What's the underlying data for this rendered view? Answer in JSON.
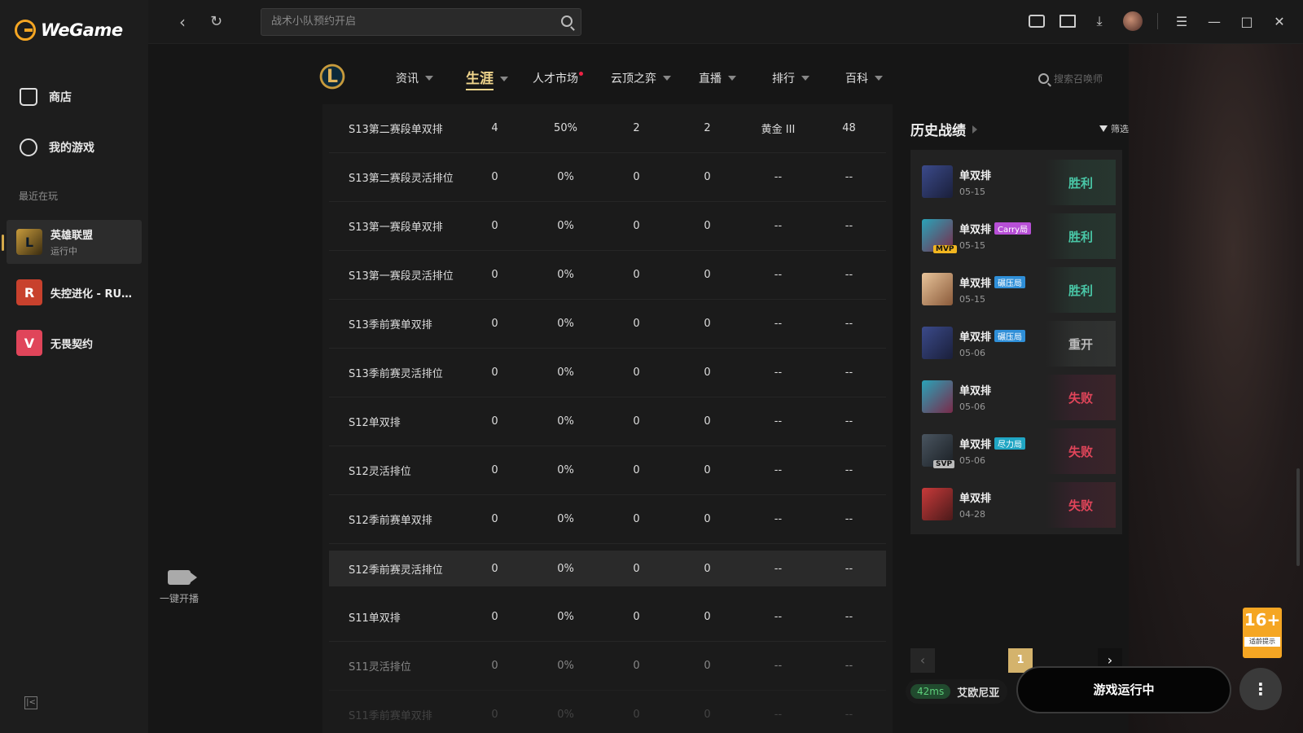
{
  "app": {
    "name": "WeGame"
  },
  "sidebar": {
    "items": [
      {
        "label": "商店",
        "icon": "bag-icon"
      },
      {
        "label": "我的游戏",
        "icon": "gamepad-icon"
      }
    ],
    "recent_label": "最近在玩",
    "games": [
      {
        "name": "英雄联盟",
        "status": "运行中",
        "icon_text": "L"
      },
      {
        "name": "失控进化 - RUS...",
        "status": "",
        "icon_text": "R"
      },
      {
        "name": "无畏契约",
        "status": "",
        "icon_text": "V"
      }
    ],
    "stream_label": "一键开播"
  },
  "topbar": {
    "search_placeholder": "战术小队预约开启"
  },
  "game_nav": {
    "tabs": [
      {
        "label": "资讯"
      },
      {
        "label": "生涯"
      },
      {
        "label": "人才市场"
      },
      {
        "label": "云顶之弈"
      },
      {
        "label": "直播"
      },
      {
        "label": "排行"
      },
      {
        "label": "百科"
      }
    ],
    "summoner_search_placeholder": "搜索召唤师"
  },
  "stats": {
    "rows": [
      {
        "name": "S13第二赛段单双排",
        "c1": "4",
        "c2": "50%",
        "c3": "2",
        "c4": "2",
        "c5": "黄金 III",
        "c6": "48"
      },
      {
        "name": "S13第二赛段灵活排位",
        "c1": "0",
        "c2": "0%",
        "c3": "0",
        "c4": "0",
        "c5": "--",
        "c6": "--"
      },
      {
        "name": "S13第一赛段单双排",
        "c1": "0",
        "c2": "0%",
        "c3": "0",
        "c4": "0",
        "c5": "--",
        "c6": "--"
      },
      {
        "name": "S13第一赛段灵活排位",
        "c1": "0",
        "c2": "0%",
        "c3": "0",
        "c4": "0",
        "c5": "--",
        "c6": "--"
      },
      {
        "name": "S13季前赛单双排",
        "c1": "0",
        "c2": "0%",
        "c3": "0",
        "c4": "0",
        "c5": "--",
        "c6": "--"
      },
      {
        "name": "S13季前赛灵活排位",
        "c1": "0",
        "c2": "0%",
        "c3": "0",
        "c4": "0",
        "c5": "--",
        "c6": "--"
      },
      {
        "name": "S12单双排",
        "c1": "0",
        "c2": "0%",
        "c3": "0",
        "c4": "0",
        "c5": "--",
        "c6": "--"
      },
      {
        "name": "S12灵活排位",
        "c1": "0",
        "c2": "0%",
        "c3": "0",
        "c4": "0",
        "c5": "--",
        "c6": "--"
      },
      {
        "name": "S12季前赛单双排",
        "c1": "0",
        "c2": "0%",
        "c3": "0",
        "c4": "0",
        "c5": "--",
        "c6": "--"
      },
      {
        "name": "S12季前赛灵活排位",
        "c1": "0",
        "c2": "0%",
        "c3": "0",
        "c4": "0",
        "c5": "--",
        "c6": "--"
      },
      {
        "name": "S11单双排",
        "c1": "0",
        "c2": "0%",
        "c3": "0",
        "c4": "0",
        "c5": "--",
        "c6": "--"
      },
      {
        "name": "S11灵活排位",
        "c1": "0",
        "c2": "0%",
        "c3": "0",
        "c4": "0",
        "c5": "--",
        "c6": "--"
      },
      {
        "name": "S11季前赛单双排",
        "c1": "0",
        "c2": "0%",
        "c3": "0",
        "c4": "0",
        "c5": "--",
        "c6": "--"
      }
    ]
  },
  "history": {
    "title": "历史战绩",
    "filter_label": "筛选",
    "matches": [
      {
        "type": "单双排",
        "tag": "",
        "date": "05-15",
        "result": "胜利",
        "badge": ""
      },
      {
        "type": "单双排",
        "tag": "Carry局",
        "date": "05-15",
        "result": "胜利",
        "badge": "MVP"
      },
      {
        "type": "单双排",
        "tag": "碾压局",
        "date": "05-15",
        "result": "胜利",
        "badge": ""
      },
      {
        "type": "单双排",
        "tag": "碾压局",
        "date": "05-06",
        "result": "重开",
        "badge": ""
      },
      {
        "type": "单双排",
        "tag": "",
        "date": "05-06",
        "result": "失败",
        "badge": ""
      },
      {
        "type": "单双排",
        "tag": "尽力局",
        "date": "05-06",
        "result": "失败",
        "badge": "SVP"
      },
      {
        "type": "单双排",
        "tag": "",
        "date": "04-28",
        "result": "失败",
        "badge": ""
      }
    ],
    "page": "1"
  },
  "age_rating": {
    "number": "16+",
    "label": "适龄提示"
  },
  "bottom": {
    "ping": "42ms",
    "server": "艾欧尼亚",
    "run_button": "游戏运行中"
  },
  "colors": {
    "accent": "#f0d58c",
    "win": "#49c6a6",
    "lose": "#e1455a",
    "brand": "#f5a623"
  }
}
